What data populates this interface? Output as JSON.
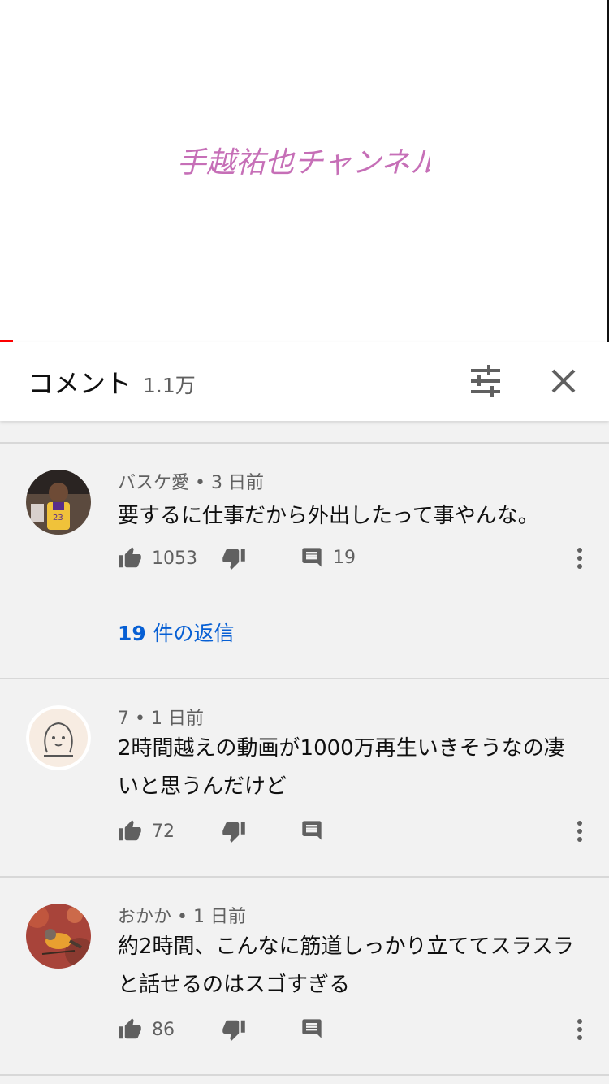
{
  "video": {
    "logo_text": "手越祐也チャンネル",
    "progress": 0.02
  },
  "header": {
    "title": "コメント",
    "count": "1.1万"
  },
  "comments": [
    {
      "author": "バスケ愛",
      "time": "3 日前",
      "text": "要するに仕事だから外出したって事やんな。",
      "likes": "1053",
      "replies_count": "19",
      "view_replies_num": "19",
      "view_replies_label": "件の返信",
      "avatar": "basketball-player"
    },
    {
      "author": "7",
      "time": "1 日前",
      "text": "2時間越えの動画が1000万再生いきそうなの凄いと思うんだけど",
      "likes": "72",
      "replies_count": "",
      "avatar": "sketch-face"
    },
    {
      "author": "おかか",
      "time": "1 日前",
      "text": "約2時間、こんなに筋道しっかり立ててスラスラと話せるのはスゴすぎる",
      "likes": "86",
      "replies_count": "",
      "avatar": "bird"
    }
  ],
  "icons": {
    "like": "thumbs-up-icon",
    "dislike": "thumbs-down-icon",
    "reply": "comment-icon",
    "more": "more-vertical-icon",
    "filter": "tune-icon",
    "close": "close-icon"
  },
  "colors": {
    "accent_link": "#065fd4",
    "progress": "#ff0000",
    "logo": "#c060b0"
  }
}
